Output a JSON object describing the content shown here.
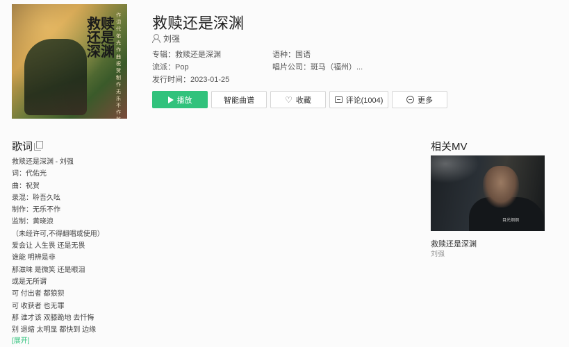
{
  "song": {
    "title": "救赎还是深渊",
    "artist": "刘强"
  },
  "cover": {
    "calligraphy": "救赎还是深渊",
    "credits": "作词 代佑光 作曲 祝贺 制作 无乐不作 监制 黄晓浪"
  },
  "meta": {
    "album_label": "专辑：",
    "album_value": "救赎还是深渊",
    "language_label": "语种：",
    "language_value": "国语",
    "genre_label": "流派：",
    "genre_value": "Pop",
    "label_label": "唱片公司：",
    "label_value": "斑马（福州）...",
    "release_label": "发行时间：",
    "release_value": "2023-01-25"
  },
  "actions": {
    "play": "播放",
    "smart_score": "智能曲谱",
    "favorite": "收藏",
    "comment": "评论(1004)",
    "more": "更多"
  },
  "lyrics": {
    "title": "歌词",
    "lines": [
      "救赎还是深渊 - 刘强",
      "词：代佑光",
      "曲：祝贺",
      "录混：聆吾久吆",
      "制作：无乐不作",
      "监制：黄晓浪",
      "（未经许可,不得翻唱或使用）",
      "爱会让 人生畏 还是无畏",
      "谁能 明辨是非",
      "那滋味 是微笑 还是眼泪",
      "或是无所谓",
      "可 付出者 都狼狈",
      "可 收获者 也无罪",
      "那 谁才该 双膝跪地 去忏悔",
      "别 退缩 太明显 都快到 边缘"
    ],
    "expand": "[展开]"
  },
  "related_mv": {
    "title": "相关MV",
    "item_title": "救赎还是深渊",
    "item_artist": "刘强",
    "thumb_caption": "目光炯炯"
  },
  "colors": {
    "accent": "#31c27c",
    "background": "#fbfbfb"
  }
}
